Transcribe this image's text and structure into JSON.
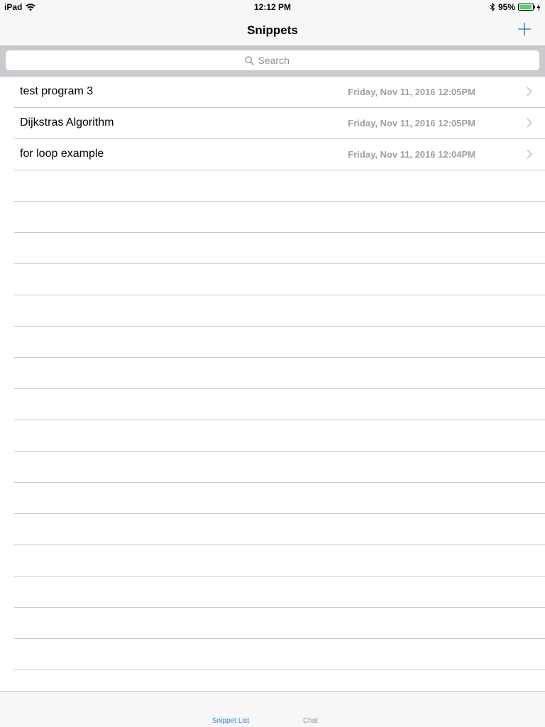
{
  "status_bar": {
    "device": "iPad",
    "time": "12:12 PM",
    "battery": "95%",
    "battery_level": 0.95,
    "battery_color": "#4cd964"
  },
  "nav": {
    "title": "Snippets",
    "add_icon": "plus-icon",
    "accent_color": "#2e82d8"
  },
  "search": {
    "placeholder": "Search",
    "icon": "search-icon"
  },
  "snippets": [
    {
      "title": "test program 3",
      "date": "Friday, Nov 11, 2016 12:05PM"
    },
    {
      "title": "Dijkstras Algorithm",
      "date": "Friday, Nov 11, 2016 12:05PM"
    },
    {
      "title": "for loop example",
      "date": "Friday, Nov 11, 2016 12:04PM"
    }
  ],
  "tabs": [
    {
      "label": "Snippet List",
      "selected": true
    },
    {
      "label": "Chat",
      "selected": false
    }
  ]
}
